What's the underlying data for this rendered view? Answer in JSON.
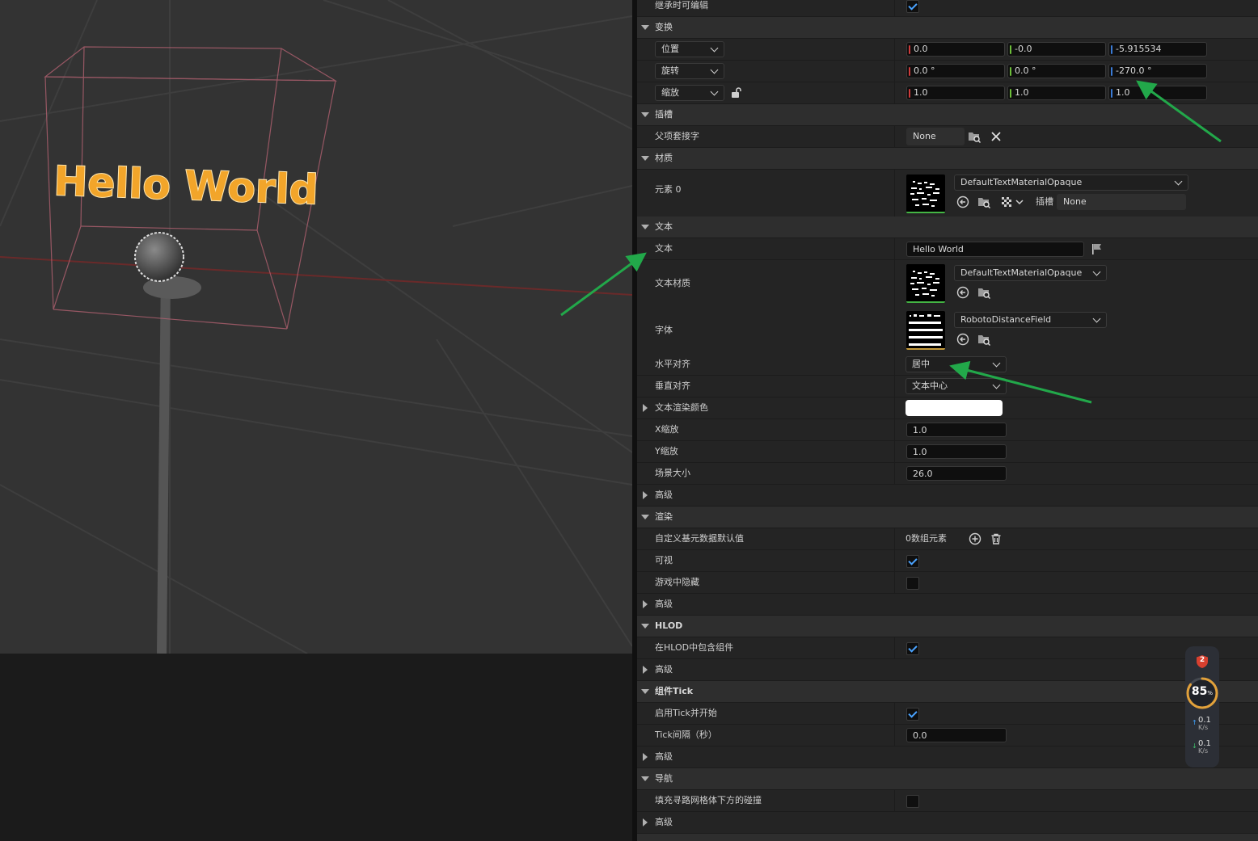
{
  "viewport": {
    "scene_text": "Hello World"
  },
  "panel": {
    "rows": [
      {
        "label": "继承时可编辑",
        "checked": true
      },
      {
        "cat": "变换"
      },
      {
        "label": "位置",
        "values": [
          "0.0",
          "-0.0",
          "-5.915534"
        ]
      },
      {
        "label": "旋转",
        "values": [
          "0.0 °",
          "0.0 °",
          "-270.0 °"
        ]
      },
      {
        "label": "缩放",
        "values": [
          "1.0",
          "1.0",
          "1.0"
        ]
      },
      {
        "cat": "插槽"
      },
      {
        "label": "父项套接字",
        "value": "None"
      },
      {
        "cat": "材质"
      },
      {
        "label": "元素 0",
        "material": "DefaultTextMaterialOpaque",
        "slot_label": "插槽",
        "slot_value": "None"
      },
      {
        "cat": "文本"
      },
      {
        "label": "文本",
        "value": "Hello World"
      },
      {
        "label": "文本材质",
        "material": "DefaultTextMaterialOpaque"
      },
      {
        "label": "字体",
        "font": "RobotoDistanceField"
      },
      {
        "label": "水平对齐",
        "value": "居中"
      },
      {
        "label": "垂直对齐",
        "value": "文本中心"
      },
      {
        "label": "文本渲染颜色",
        "color": "#ffffff"
      },
      {
        "label": "X缩放",
        "value": "1.0"
      },
      {
        "label": "Y缩放",
        "value": "1.0"
      },
      {
        "label": "场景大小",
        "value": "26.0"
      },
      {
        "label": "高级"
      },
      {
        "cat": "渲染"
      },
      {
        "label": "自定义基元数据默认值",
        "value": "0数组元素"
      },
      {
        "label": "可视",
        "checked": true
      },
      {
        "label": "游戏中隐藏",
        "checked": false
      },
      {
        "label": "高级"
      },
      {
        "cat": "HLOD"
      },
      {
        "label": "在HLOD中包含组件",
        "checked": true
      },
      {
        "label": "高级"
      },
      {
        "cat": "组件Tick"
      },
      {
        "label": "启用Tick并开始",
        "checked": true
      },
      {
        "label": "Tick间隔（秒）",
        "value": "0.0"
      },
      {
        "label": "高级"
      },
      {
        "cat": "导航"
      },
      {
        "label": "填充寻路网格体下方的碰撞",
        "checked": false
      },
      {
        "label": "高级"
      }
    ]
  },
  "widget": {
    "badge": "2",
    "percent": "85",
    "percent_unit": "%",
    "up_speed": "0.1",
    "down_speed": "0.1",
    "speed_unit": "K/s"
  },
  "colors": {
    "x_axis": "#d03a3a",
    "y_axis": "#6dbf3a",
    "z_axis": "#3a7bd5",
    "check": "#4aa3ff",
    "annotation_arrow": "#22a84a"
  }
}
